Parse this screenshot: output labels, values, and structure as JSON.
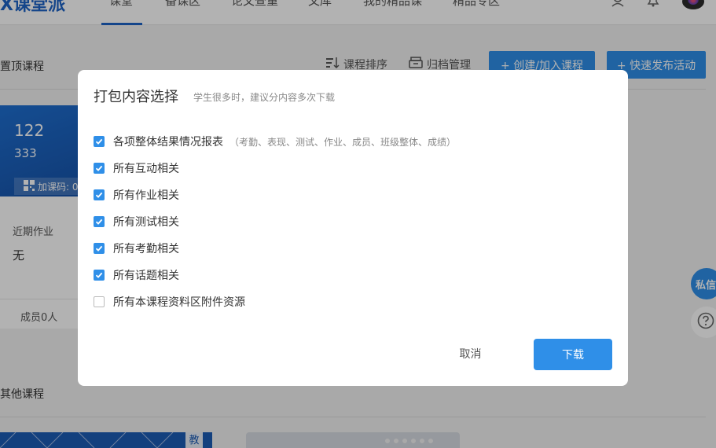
{
  "topnav": {
    "logo": "X课堂派",
    "items": [
      {
        "label": "课堂"
      },
      {
        "label": "备课区"
      },
      {
        "label": "论文查重"
      },
      {
        "label": "文库"
      },
      {
        "label": "我的精品课"
      },
      {
        "label": "精品专区"
      }
    ],
    "active_index": 0
  },
  "page": {
    "pinned_title": "置顶课程",
    "sort_label": "课程排序",
    "archive_label": "归档管理",
    "create_join_label": "+ 创建/加入课程",
    "quick_publish_label": "+ 快速发布活动",
    "other_title": "其他课程"
  },
  "course_card": {
    "name": "122",
    "class_name": "333",
    "join_code_label": "加课码: 0",
    "homework_label": "近期作业",
    "homework_value": "无",
    "members_label": "成员0人"
  },
  "thumb_tag": "教",
  "float_buttons": {
    "message_label": "私信"
  },
  "modal": {
    "title": "打包内容选择",
    "hint": "学生很多时，建议分内容多次下载",
    "options": [
      {
        "label": "各项整体结果情况报表",
        "note": "（考勤、表现、测试、作业、成员、班级整体、成绩）",
        "checked": true
      },
      {
        "label": "所有互动相关",
        "checked": true
      },
      {
        "label": "所有作业相关",
        "checked": true
      },
      {
        "label": "所有测试相关",
        "checked": true
      },
      {
        "label": "所有考勤相关",
        "checked": true
      },
      {
        "label": "所有话题相关",
        "checked": true
      },
      {
        "label": "所有本课程资料区附件资源",
        "checked": false
      }
    ],
    "cancel_label": "取消",
    "download_label": "下载"
  },
  "colors": {
    "accent": "#2f8fe8",
    "brand": "#1e63c6"
  }
}
